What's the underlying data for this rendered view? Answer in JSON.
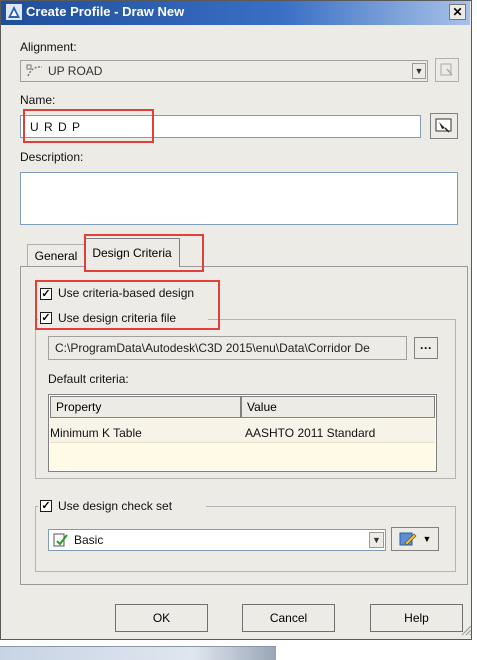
{
  "window": {
    "title": "Create Profile - Draw New",
    "close_label": "✕"
  },
  "alignment": {
    "label": "Alignment:",
    "value": "UP ROAD"
  },
  "name": {
    "label": "Name:",
    "value": "U R D P"
  },
  "description": {
    "label": "Description:",
    "value": ""
  },
  "tabs": [
    {
      "label": "General",
      "selected": false
    },
    {
      "label": "Design Criteria",
      "selected": true
    }
  ],
  "design_criteria": {
    "use_criteria_based": {
      "label": "Use criteria-based design",
      "checked": true
    },
    "use_criteria_file": {
      "label": "Use design criteria file",
      "checked": true
    },
    "file_path": "C:\\ProgramData\\Autodesk\\C3D 2015\\enu\\Data\\Corridor De",
    "browse_label": "···",
    "default_criteria_label": "Default criteria:",
    "table": {
      "headers": [
        "Property",
        "Value"
      ],
      "rows": [
        [
          "Minimum K Table",
          "AASHTO 2011 Standard"
        ]
      ]
    },
    "use_check_set": {
      "label": "Use design check set",
      "checked": true
    },
    "check_set_value": "Basic"
  },
  "buttons": {
    "ok": "OK",
    "cancel": "Cancel",
    "help": "Help"
  },
  "highlight_color": "#e0403a"
}
